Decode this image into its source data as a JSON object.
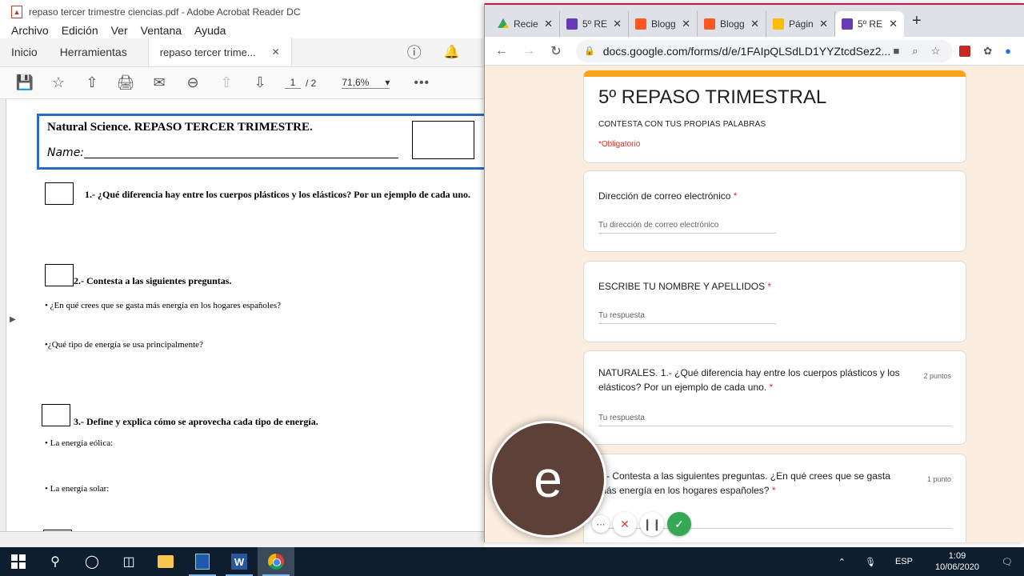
{
  "acrobat": {
    "window_title": "repaso tercer trimestre ciencias.pdf - Adobe Acrobat Reader DC",
    "menu": [
      "Archivo",
      "Edición",
      "Ver",
      "Ventana",
      "Ayuda"
    ],
    "tabs": {
      "home": "Inicio",
      "tools": "Herramientas",
      "doc": "repaso tercer trime..."
    },
    "toolbar": {
      "page_current": "1",
      "page_total": "/ 2",
      "zoom": "71,6%"
    },
    "icons": [
      "save-icon",
      "star-icon",
      "upload-icon",
      "print-icon",
      "mail-icon",
      "zoom-out-icon",
      "page-up-icon",
      "page-down-icon",
      "more-icon"
    ]
  },
  "pdf": {
    "title": "Natural Science. REPASO TERCER TRIMESTRE.",
    "name_label": "Name:",
    "q1": "1.- ¿Qué diferencia hay entre los cuerpos plásticos y los elásticos? Por un ejemplo de cada uno.",
    "q2": "2.- Contesta a las siguientes preguntas.",
    "q2_a": "• ¿En qué crees que se gasta más energía en los hogares españoles?",
    "q2_b": "•¿Qué tipo de energía se usa principalmente?",
    "q3": "3.- Define y explica cómo se aprovecha cada tipo de energía.",
    "q3_a": "• La energía eólica:",
    "q3_b": "• La energía solar:"
  },
  "chrome": {
    "tabs": [
      {
        "label": "Recie",
        "favicon": "drive"
      },
      {
        "label": "5º RE",
        "favicon": "forms"
      },
      {
        "label": "Blogg",
        "favicon": "blogger"
      },
      {
        "label": "Blogg",
        "favicon": "blogger"
      },
      {
        "label": "Págin",
        "favicon": "pages"
      },
      {
        "label": "5º RE",
        "favicon": "forms",
        "active": true
      }
    ],
    "url": "docs.google.com/forms/d/e/1FAIpQLSdLD1YYZtcdSez2..."
  },
  "form": {
    "title": "5º REPASO TRIMESTRAL",
    "description": "CONTESTA CON TUS PROPIAS PALABRAS",
    "required_note": "*Obligatorio",
    "questions": [
      {
        "label": "Dirección de correo electrónico",
        "required": "*",
        "placeholder": "Tu dirección de correo electrónico",
        "points": ""
      },
      {
        "label": "ESCRIBE TU NOMBRE Y APELLIDOS",
        "required": "*",
        "placeholder": "Tu respuesta",
        "points": ""
      },
      {
        "label": "NATURALES. 1.- ¿Qué diferencia hay entre los cuerpos plásticos y los elásticos? Por un ejemplo de cada uno.",
        "required": "*",
        "placeholder": "Tu respuesta",
        "points": "2 puntos"
      },
      {
        "label": "2.- Contesta a las siguientes preguntas. ¿En qué crees que se gasta más energía en los hogares españoles?",
        "required": "*",
        "placeholder": "",
        "points": "1 punto"
      }
    ]
  },
  "webcam": {
    "initial": "e"
  },
  "taskbar": {
    "language": "ESP",
    "time": "1:09",
    "date": "10/06/2020"
  },
  "colors": {
    "form_accent": "#f9a21b",
    "form_background": "#fbeee0",
    "required_red": "#d93025",
    "pdf_frame_blue": "#2a6bbf",
    "record_done_green": "#34a853"
  }
}
